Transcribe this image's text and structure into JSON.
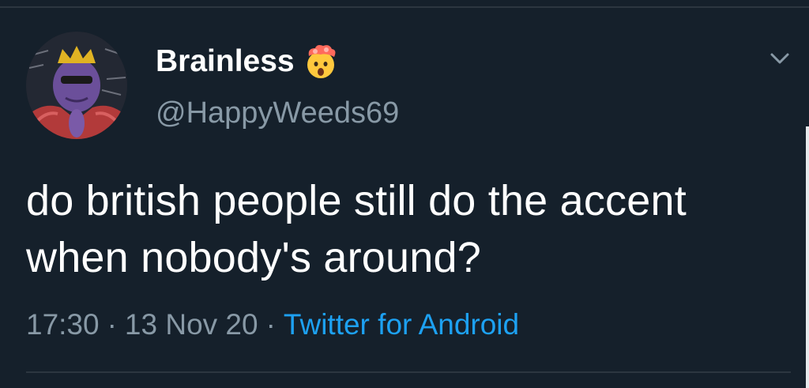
{
  "tweet": {
    "display_name": "Brainless",
    "name_emoji": "exploding-head-emoji",
    "handle": "@HappyWeeds69",
    "text": "do british people still do the accent when nobody's around?",
    "time": "17:30",
    "date": "13 Nov 20",
    "separator": "·",
    "source": "Twitter for Android"
  },
  "icons": {
    "more_options": "chevron-down-icon",
    "avatar": "profile-avatar-image"
  },
  "colors": {
    "background": "#15202b",
    "primary_text": "#ffffff",
    "secondary_text": "#8899a6",
    "link": "#1da1f2",
    "divider": "#2c3640"
  }
}
